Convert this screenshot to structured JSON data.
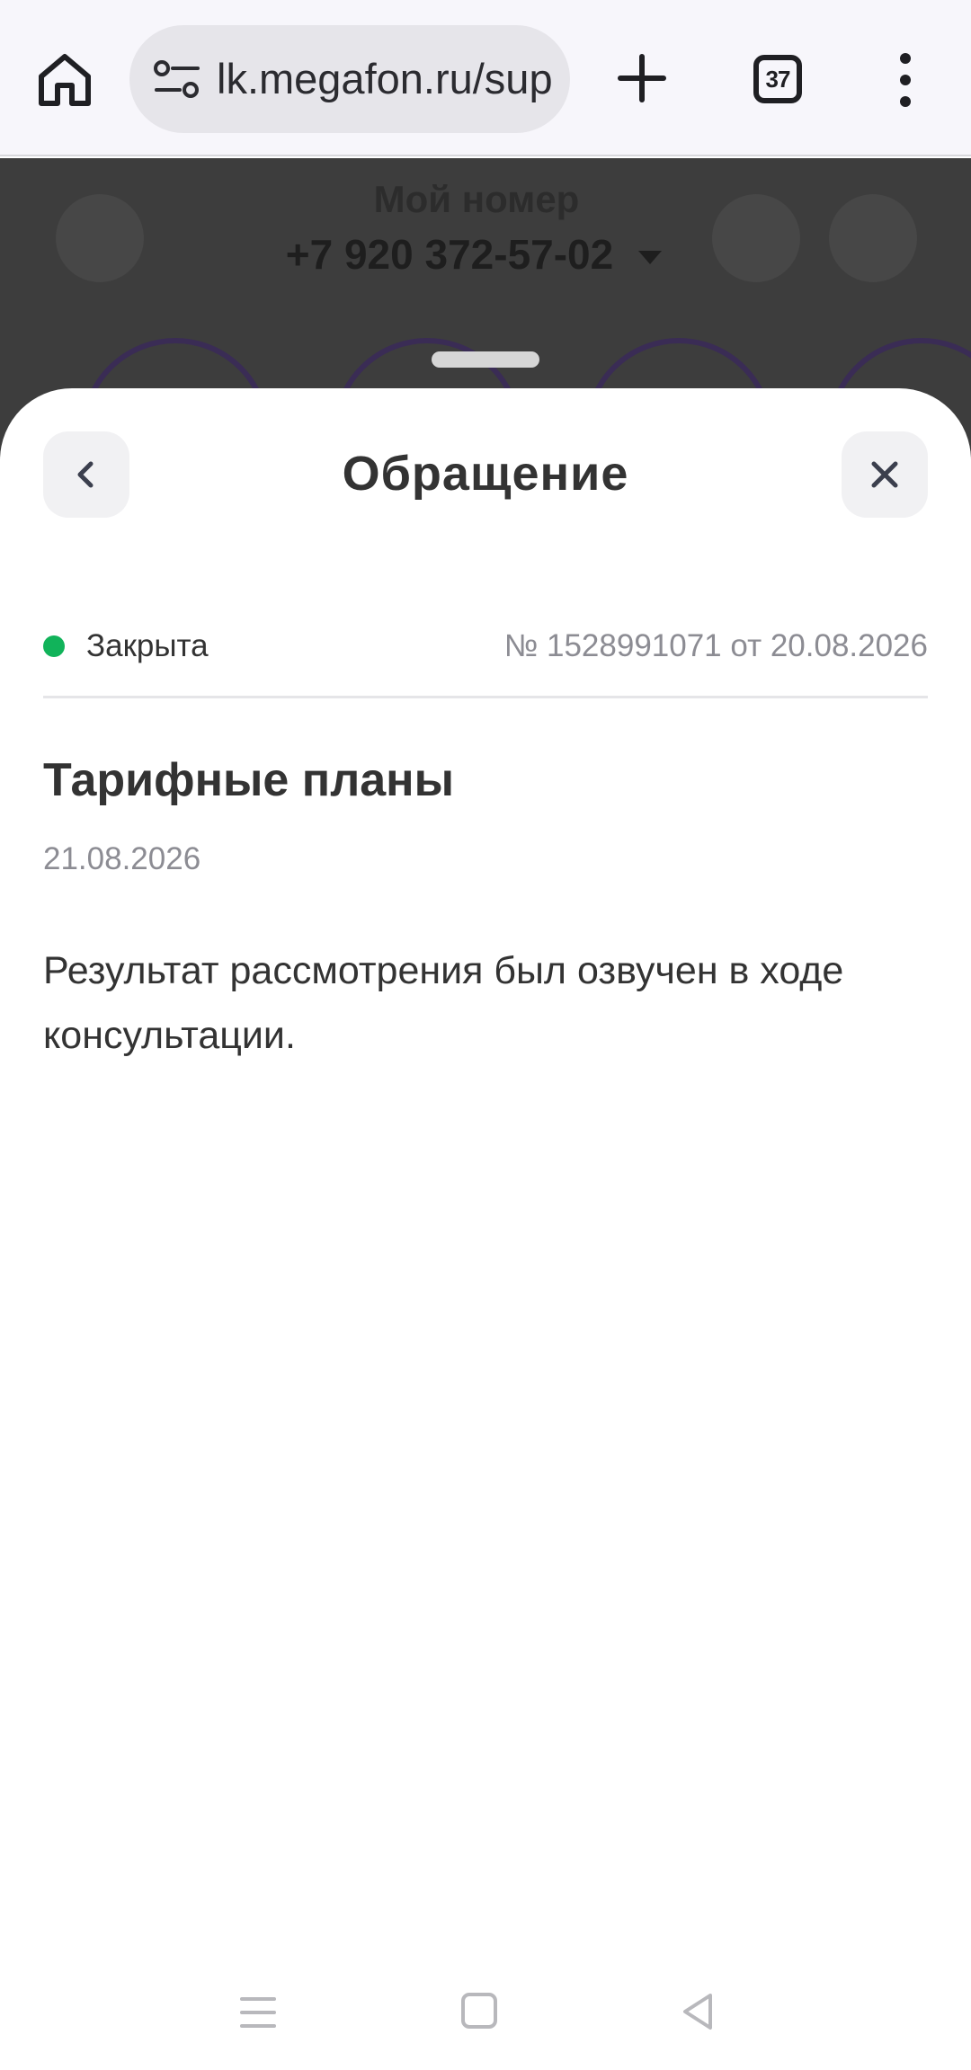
{
  "browser": {
    "url": "lk.megafon.ru/support",
    "tab_count": "37"
  },
  "background_page": {
    "title": "Мой номер",
    "phone_number": "+7 920 372-57-02"
  },
  "sheet": {
    "title": "Обращение",
    "status_label": "Закрыта",
    "status_color": "#11b35a",
    "ticket_info": "№ 1528991071 от 20.08.2026",
    "topic": "Тарифные планы",
    "topic_date": "21.08.2026",
    "result_text": "Результат рассмотрения был озвучен в ходе консультации."
  },
  "icons": {
    "home": "home-icon",
    "site_settings": "site-settings-icon",
    "new_tab": "plus-icon",
    "tabs": "tabs-icon",
    "menu": "more-vert-icon",
    "back": "chevron-left-icon",
    "close": "close-icon"
  }
}
